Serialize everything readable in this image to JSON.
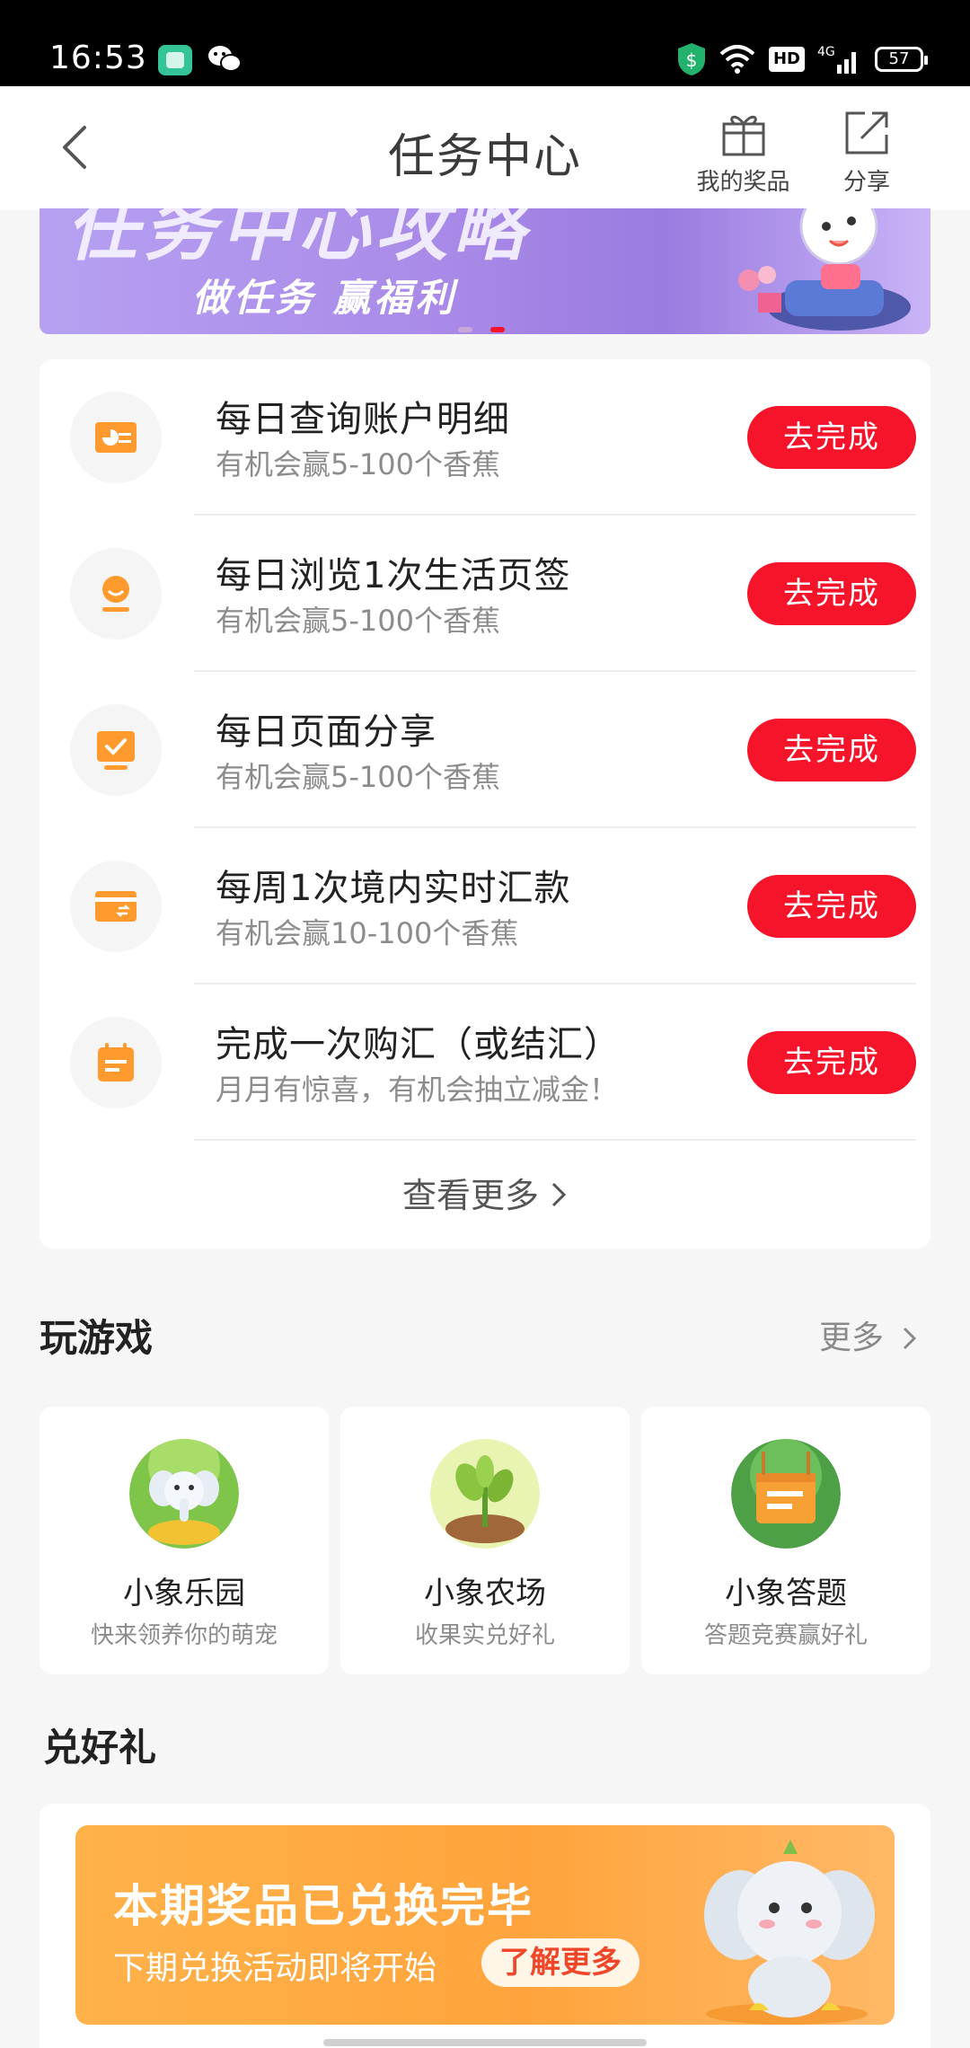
{
  "status_bar": {
    "time": "16:53",
    "network": "4G",
    "hd_label": "HD",
    "battery": "57"
  },
  "header": {
    "title": "任务中心",
    "prizes_label": "我的奖品",
    "share_label": "分享"
  },
  "banner": {
    "headline": "任务中心攻略",
    "subtitle": "做任务 赢福利",
    "active_slide": 2,
    "slide_count": 2
  },
  "tasks": [
    {
      "title": "每日查询账户明细",
      "subtitle": "有机会赢5-100个香蕉",
      "button": "去完成",
      "icon": "account-detail-icon"
    },
    {
      "title": "每日浏览1次生活页签",
      "subtitle": "有机会赢5-100个香蕉",
      "button": "去完成",
      "icon": "life-tab-icon"
    },
    {
      "title": "每日页面分享",
      "subtitle": "有机会赢5-100个香蕉",
      "button": "去完成",
      "icon": "page-share-icon"
    },
    {
      "title": "每周1次境内实时汇款",
      "subtitle": "有机会赢10-100个香蕉",
      "button": "去完成",
      "icon": "remittance-card-icon"
    },
    {
      "title": "完成一次购汇（或结汇）",
      "subtitle": "月月有惊喜，有机会抽立减金！",
      "button": "去完成",
      "icon": "calendar-icon"
    }
  ],
  "view_more": "查看更多",
  "games_section": {
    "title": "玩游戏",
    "more": "更多",
    "games": [
      {
        "name": "小象乐园",
        "subtitle": "快来领养你的萌宠"
      },
      {
        "name": "小象农场",
        "subtitle": "收果实兑好礼"
      },
      {
        "name": "小象答题",
        "subtitle": "答题竞赛赢好礼"
      }
    ]
  },
  "redeem_section": {
    "title": "兑好礼",
    "headline": "本期奖品已兑换完毕",
    "subtitle": "下期兑换活动即将开始",
    "button": "了解更多"
  },
  "colors": {
    "accent_red": "#f5142a",
    "icon_orange": "#ff9a2e",
    "redeem_orange": "#ffa43d",
    "banner_purple": "#a98ae8"
  }
}
